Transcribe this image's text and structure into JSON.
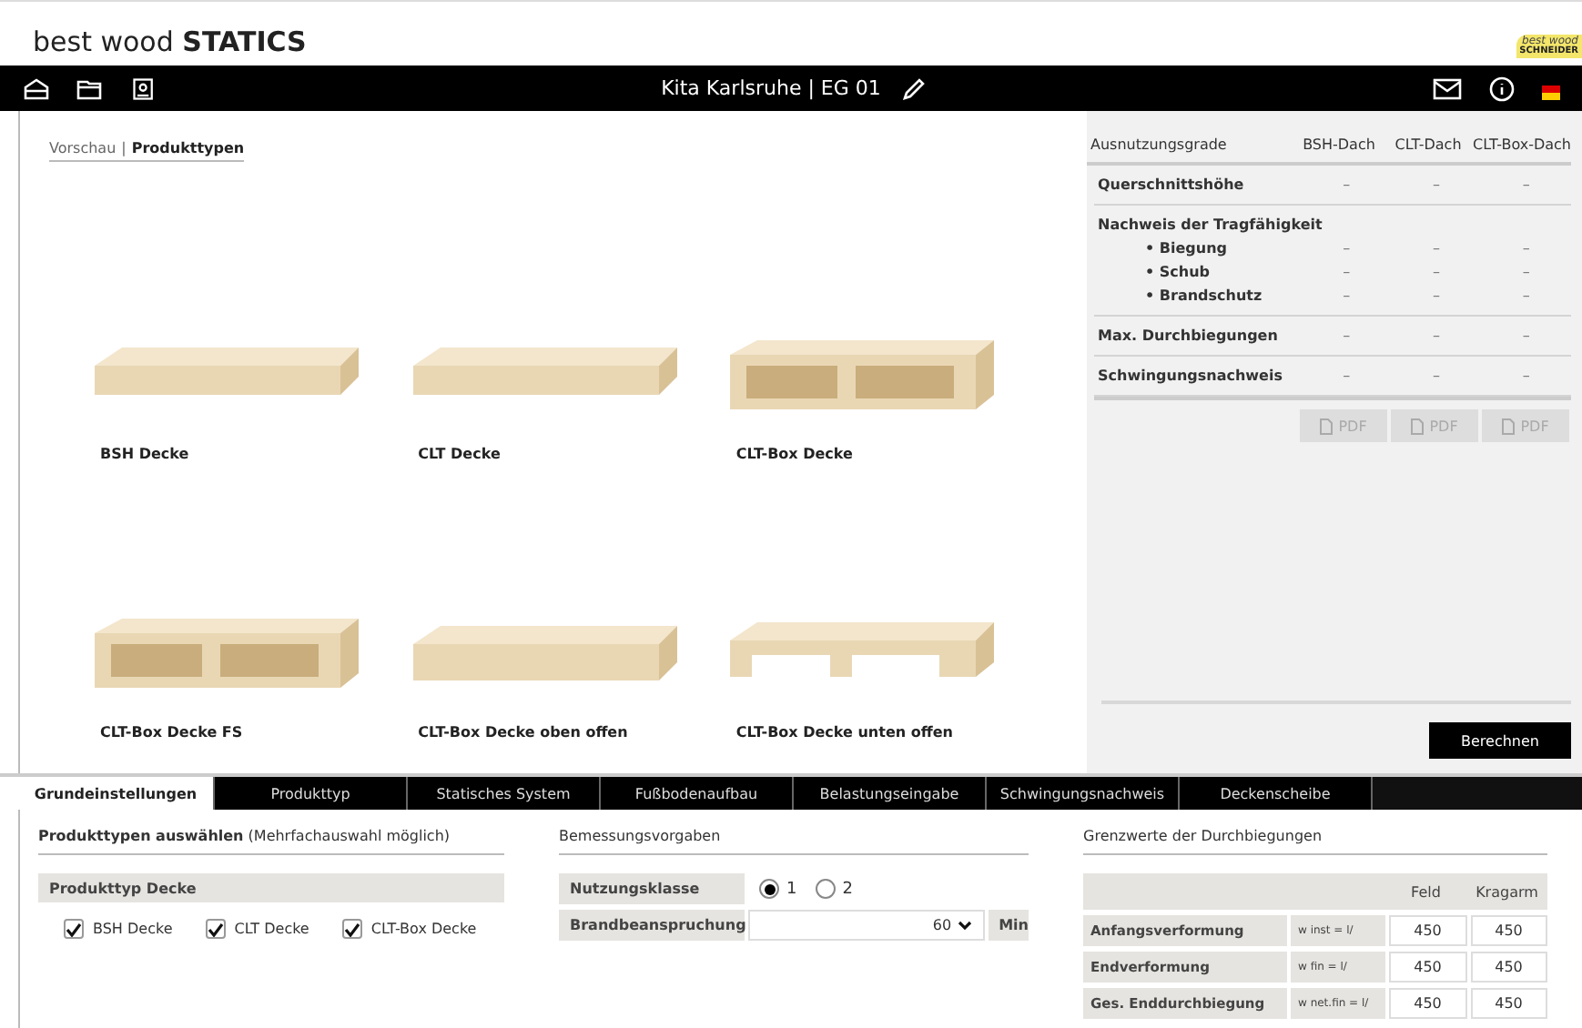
{
  "app": {
    "title_light": "best wood",
    "title_bold": "STATICS",
    "logo_top": "best wood",
    "logo_bottom": "SCHNEIDER"
  },
  "toolbar": {
    "project": "Kita Karlsruhe | EG 01"
  },
  "breadcrumb_separator": "|",
  "breadcrumb": [
    {
      "label": "Vorschau",
      "selected": false
    },
    {
      "label": "Produkttypen",
      "selected": true
    }
  ],
  "products": [
    {
      "label": "BSH Decke",
      "kind": "slab"
    },
    {
      "label": "CLT Decke",
      "kind": "slab"
    },
    {
      "label": "CLT-Box Decke",
      "kind": "box"
    },
    {
      "label": "CLT-Box Decke FS",
      "kind": "box"
    },
    {
      "label": "CLT-Box Decke oben offen",
      "kind": "open-top"
    },
    {
      "label": "CLT-Box Decke unten offen",
      "kind": "open-bottom"
    }
  ],
  "results": {
    "columns": [
      "Ausnutzungsgrade",
      "BSH-Dach",
      "CLT-Dach",
      "CLT-Box-Dach"
    ],
    "sections": [
      {
        "rows": [
          {
            "label": "Querschnittshöhe",
            "kind": "main",
            "values": [
              "–",
              "–",
              "–"
            ]
          }
        ]
      },
      {
        "rows": [
          {
            "label": "Nachweis der Tragfähigkeit",
            "kind": "heading"
          },
          {
            "label": "• Biegung",
            "kind": "sub",
            "values": [
              "–",
              "–",
              "–"
            ]
          },
          {
            "label": "• Schub",
            "kind": "sub",
            "values": [
              "–",
              "–",
              "–"
            ]
          },
          {
            "label": "• Brandschutz",
            "kind": "sub",
            "values": [
              "–",
              "–",
              "–"
            ]
          }
        ]
      },
      {
        "rows": [
          {
            "label": "Max. Durchbiegungen",
            "kind": "main",
            "values": [
              "–",
              "–",
              "–"
            ]
          }
        ]
      },
      {
        "rows": [
          {
            "label": "Schwingungsnachweis",
            "kind": "main",
            "values": [
              "–",
              "–",
              "–"
            ]
          }
        ]
      }
    ],
    "pdf_buttons": [
      {
        "label": "PDF",
        "disabled": true
      },
      {
        "label": "PDF",
        "disabled": true
      },
      {
        "label": "PDF",
        "disabled": true
      }
    ],
    "calculate": "Berechnen"
  },
  "tabs": [
    {
      "label": "Grundeinstellungen",
      "selected": true
    },
    {
      "label": "Produkttyp",
      "selected": false
    },
    {
      "label": "Statisches System",
      "selected": false
    },
    {
      "label": "Fußbodenaufbau",
      "selected": false
    },
    {
      "label": "Belastungseingabe",
      "selected": false
    },
    {
      "label": "Schwingungsnachweis",
      "selected": false
    },
    {
      "label": "Deckenscheibe",
      "selected": false
    }
  ],
  "product_types": {
    "title": "**Produkttypen auswählen** (Mehrfachauswahl möglich)",
    "group": "Produkttyp Decke",
    "options": [
      {
        "label": "BSH Decke",
        "checked": true
      },
      {
        "label": "CLT Decke",
        "checked": true
      },
      {
        "label": "CLT-Box Decke",
        "checked": true
      }
    ]
  },
  "design": {
    "title": "Bemessungsvorgaben",
    "usage_label": "Nutzungsklasse",
    "usage_options": [
      {
        "label": "1",
        "selected": true
      },
      {
        "label": "2",
        "selected": false
      }
    ],
    "fire_label": "Brandbeanspruchung",
    "fire_value": "60",
    "fire_unit": "Min"
  },
  "limits": {
    "title": "Grenzwerte der Durchbiegungen",
    "columns": [
      "Feld",
      "Kragarm"
    ],
    "rows": [
      {
        "label": "Anfangsverformung",
        "formula": "w inst = l/",
        "field": "450",
        "cantilever": "450"
      },
      {
        "label": "Endverformung",
        "formula": "w fin = l/",
        "field": "450",
        "cantilever": "450"
      },
      {
        "label": "Ges. Enddurchbiegung",
        "formula": "w net.fin = l/",
        "field": "450",
        "cantilever": "450"
      }
    ]
  }
}
